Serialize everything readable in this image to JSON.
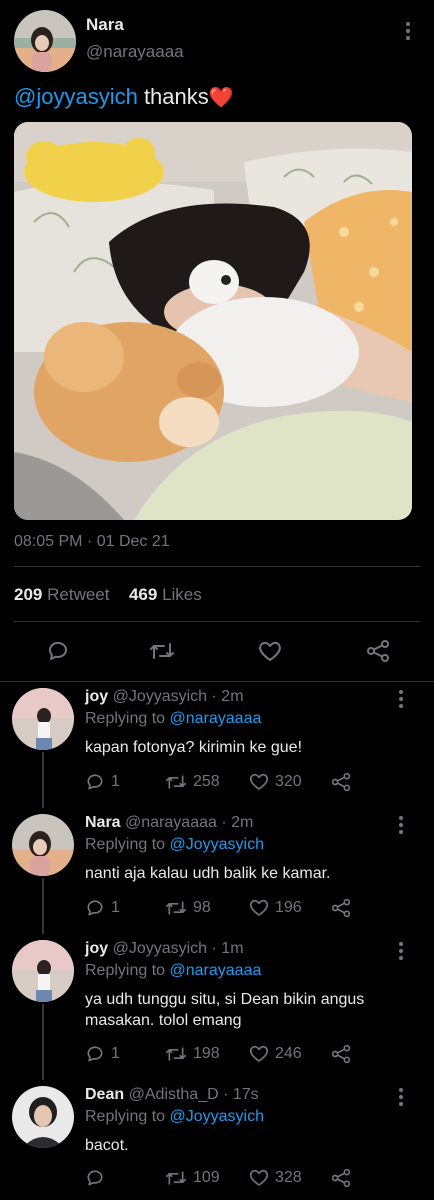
{
  "tweet": {
    "name": "Nara",
    "handle": "@narayaaaa",
    "mention": "@joyyasyich",
    "text": " thanks",
    "heart_emoji": "❤️",
    "timestamp": "08:05 PM · 01 Dec 21",
    "retweet_count": "209",
    "retweet_label": "Retweet",
    "likes_count": "469",
    "likes_label": "Likes"
  },
  "replies": [
    {
      "name": "joy",
      "handle": "@Joyyasyich",
      "time": "· 2m",
      "replying_prefix": "Replying to ",
      "replying_to": "@narayaaaa",
      "text": "kapan fotonya? kirimin ke gue!",
      "reply_count": "1",
      "retweet_count": "258",
      "like_count": "320"
    },
    {
      "name": "Nara",
      "handle": "@narayaaaa",
      "time": "· 2m",
      "replying_prefix": "Replying to ",
      "replying_to": "@Joyyasyich",
      "text": "nanti aja kalau udh balik ke kamar.",
      "reply_count": "1",
      "retweet_count": "98",
      "like_count": "196"
    },
    {
      "name": "joy",
      "handle": "@Joyyasyich",
      "time": "· 1m",
      "replying_prefix": "Replying to ",
      "replying_to": "@narayaaaa",
      "text": "ya udh tunggu situ, si Dean bikin angus masakan. tolol emang",
      "reply_count": "1",
      "retweet_count": "198",
      "like_count": "246"
    },
    {
      "name": "Dean",
      "handle": "@Adistha_D",
      "time": "· 17s",
      "replying_prefix": "Replying to ",
      "replying_to": "@Joyyasyich",
      "text": "bacot.",
      "reply_count": "",
      "retweet_count": "109",
      "like_count": "328"
    }
  ],
  "icons": {
    "reply": "reply-icon",
    "retweet": "retweet-icon",
    "like": "heart-icon",
    "share": "share-icon",
    "more": "more-icon"
  },
  "colors": {
    "background": "#000000",
    "link": "#1d9bf0",
    "heart": "#e0245e",
    "muted": "#71767b"
  }
}
